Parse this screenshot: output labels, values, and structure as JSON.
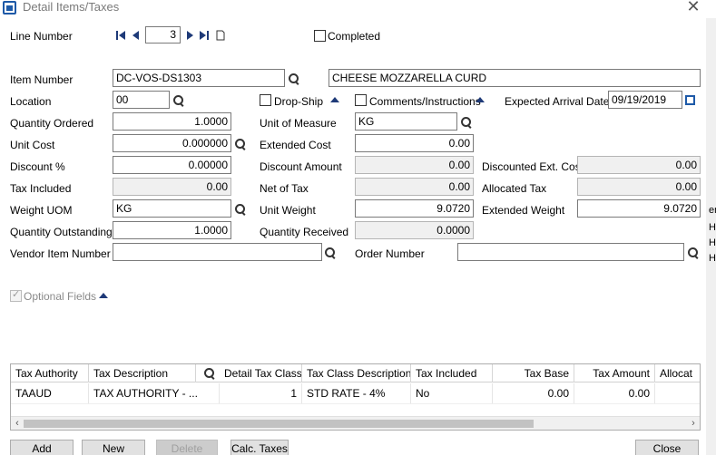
{
  "window": {
    "title": "Detail Items/Taxes",
    "close_icon": "close-icon"
  },
  "line_number": {
    "label": "Line Number",
    "value": "3"
  },
  "completed_label": "Completed",
  "item_number": {
    "label": "Item Number",
    "value": "DC-VOS-DS1303",
    "description": "CHEESE MOZZARELLA CURD"
  },
  "location": {
    "label": "Location",
    "value": "00"
  },
  "drop_ship_label": "Drop-Ship",
  "comments_label": "Comments/Instructions",
  "expected_arrival": {
    "label": "Expected Arrival Date",
    "value": "09/19/2019"
  },
  "quantity_ordered": {
    "label": "Quantity Ordered",
    "value": "1.0000"
  },
  "unit_of_measure": {
    "label": "Unit of Measure",
    "value": "KG"
  },
  "unit_cost": {
    "label": "Unit Cost",
    "value": "0.000000"
  },
  "extended_cost": {
    "label": "Extended Cost",
    "value": "0.00"
  },
  "discount_pct": {
    "label": "Discount %",
    "value": "0.00000"
  },
  "discount_amount": {
    "label": "Discount Amount",
    "value": "0.00"
  },
  "discounted_ext_cost": {
    "label": "Discounted Ext. Cost",
    "value": "0.00"
  },
  "tax_included": {
    "label": "Tax Included",
    "value": "0.00"
  },
  "net_of_tax": {
    "label": "Net of Tax",
    "value": "0.00"
  },
  "allocated_tax": {
    "label": "Allocated Tax",
    "value": "0.00"
  },
  "weight_uom": {
    "label": "Weight UOM",
    "value": "KG"
  },
  "unit_weight": {
    "label": "Unit Weight",
    "value": "9.0720"
  },
  "extended_weight": {
    "label": "Extended Weight",
    "value": "9.0720"
  },
  "quantity_outstanding": {
    "label": "Quantity Outstanding",
    "value": "1.0000"
  },
  "quantity_received": {
    "label": "Quantity Received",
    "value": "0.0000"
  },
  "vendor_item_number": {
    "label": "Vendor Item Number",
    "value": ""
  },
  "order_number": {
    "label": "Order Number",
    "value": ""
  },
  "optional_fields_label": "Optional Fields",
  "edge_fragments": [
    "em",
    "HE",
    "HE",
    "HE"
  ],
  "tax_grid": {
    "columns": [
      "Tax Authority",
      "Tax Description",
      "Detail Tax Class",
      "Tax Class Description",
      "Tax Included",
      "Tax Base",
      "Tax Amount",
      "Allocat"
    ],
    "rows": [
      [
        "TAAUD",
        "TAX AUTHORITY - ...",
        "1",
        "STD RATE - 4%",
        "No",
        "0.00",
        "0.00",
        ""
      ]
    ]
  },
  "buttons": {
    "add": "Add",
    "new": "New",
    "delete": "Delete",
    "calc_taxes": "Calc. Taxes",
    "close": "Close"
  },
  "colors": {
    "accent": "#1e3a78",
    "icon_blue": "#1e5aa8",
    "readonly_bg": "#f0f0f0"
  }
}
